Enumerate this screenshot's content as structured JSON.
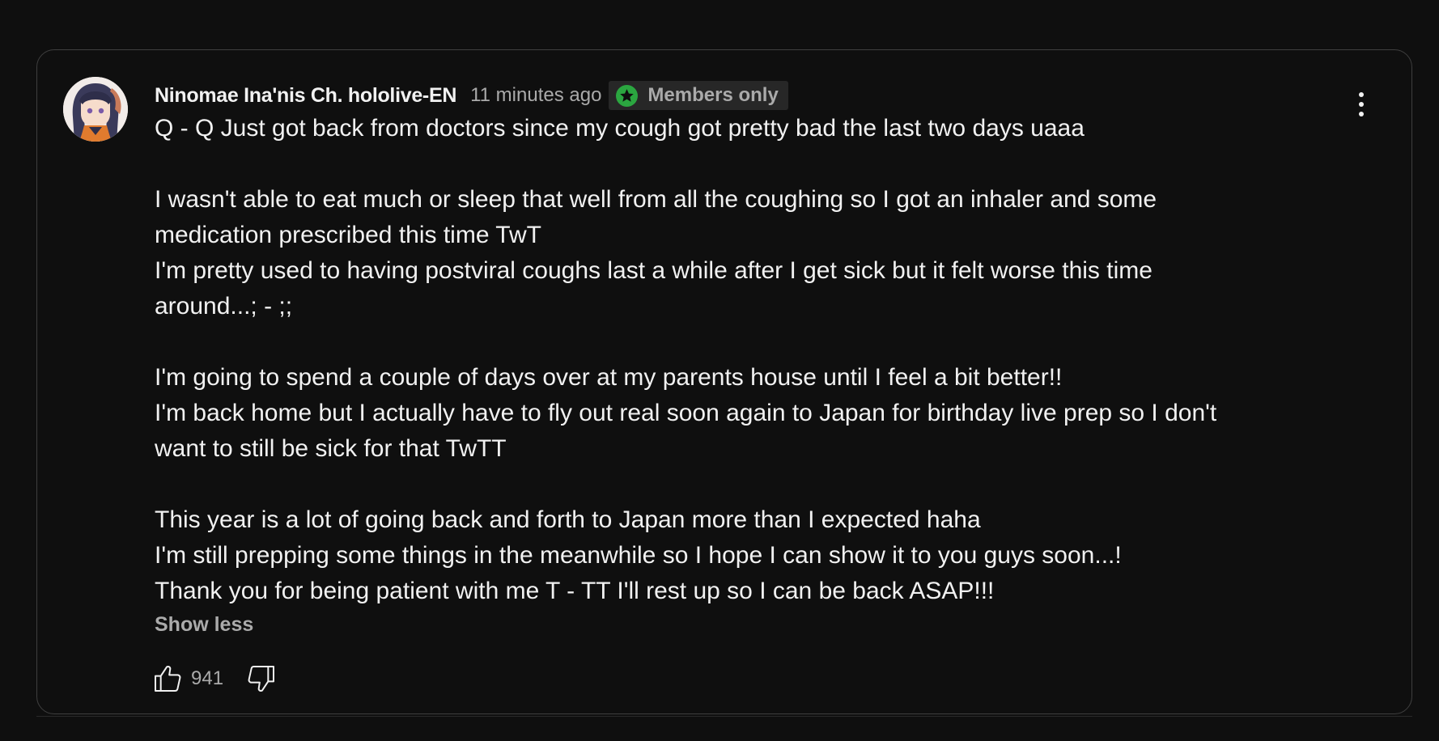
{
  "post": {
    "author": "Ninomae Ina'nis Ch. hololive-EN",
    "timestamp": "11 minutes ago",
    "badge": {
      "label": "Members only",
      "icon": "star-badge-icon",
      "icon_color": "#2ba640"
    },
    "menu_icon": "more-vert-icon",
    "body_lines": [
      "Q - Q Just got back from doctors since my cough got pretty bad the last two days uaaa",
      "",
      "I wasn't able to eat much or sleep that well from all the coughing so I got an inhaler and some",
      "medication prescribed this time TwT",
      "I'm pretty used to having postviral coughs last a while after I get sick but it felt worse this time",
      "around...; - ;;",
      "",
      "I'm going to spend a couple of days over at my parents house until I feel a bit better!!",
      "I'm back home but I actually have to fly out real soon again to Japan for birthday live prep so I don't",
      "want to still be sick for that TwTT",
      "",
      "This year is a lot of going back and forth to Japan more than I expected haha",
      "I'm still prepping some things in the meanwhile so I hope I can show it to you guys soon...!",
      "Thank you for being patient with me T - TT I'll rest up so I can be back ASAP!!!"
    ],
    "show_less_label": "Show less",
    "like_count": "941",
    "like_icon": "thumbs-up-icon",
    "dislike_icon": "thumbs-down-icon"
  },
  "colors": {
    "background": "#0f0f0f",
    "card_border": "#3f3f3f",
    "primary_text": "#f1f1f1",
    "secondary_text": "#aaaaaa",
    "badge_background": "#272727"
  }
}
